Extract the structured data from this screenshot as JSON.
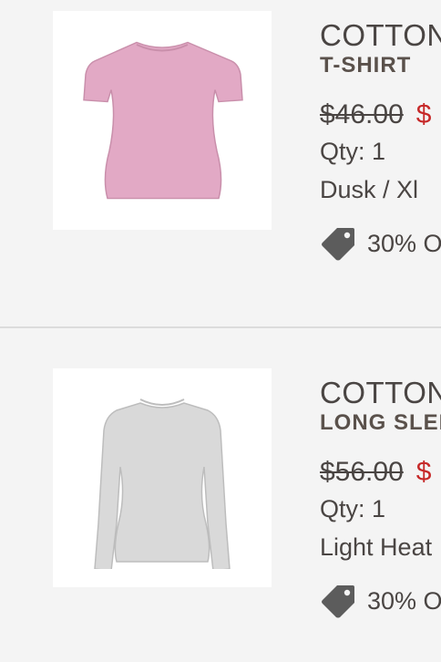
{
  "items": [
    {
      "image_alt": "Pink short-sleeve t-shirt",
      "name": "COTTON",
      "subname": "T-SHIRT",
      "price_original": "$46.00",
      "price_sale": "$",
      "qty": "Qty: 1",
      "variant": "Dusk / Xl",
      "promo": "30% O",
      "shirt_color": "#e2a9c5"
    },
    {
      "image_alt": "Light heather grey long-sleeve shirt",
      "name": "COTTON",
      "subname": "LONG SLEE",
      "price_original": "$56.00",
      "price_sale": "$",
      "qty": "Qty: 1",
      "variant": "Light Heat",
      "promo": "30% O",
      "shirt_color": "#d9d9d9"
    }
  ],
  "colors": {
    "text": "#4a4543",
    "sale": "#c62828",
    "tag_icon": "#5c5c5c",
    "background": "#f4f4f4",
    "divider": "#dcdcdc"
  },
  "icons": {
    "promo": "tag-icon"
  }
}
